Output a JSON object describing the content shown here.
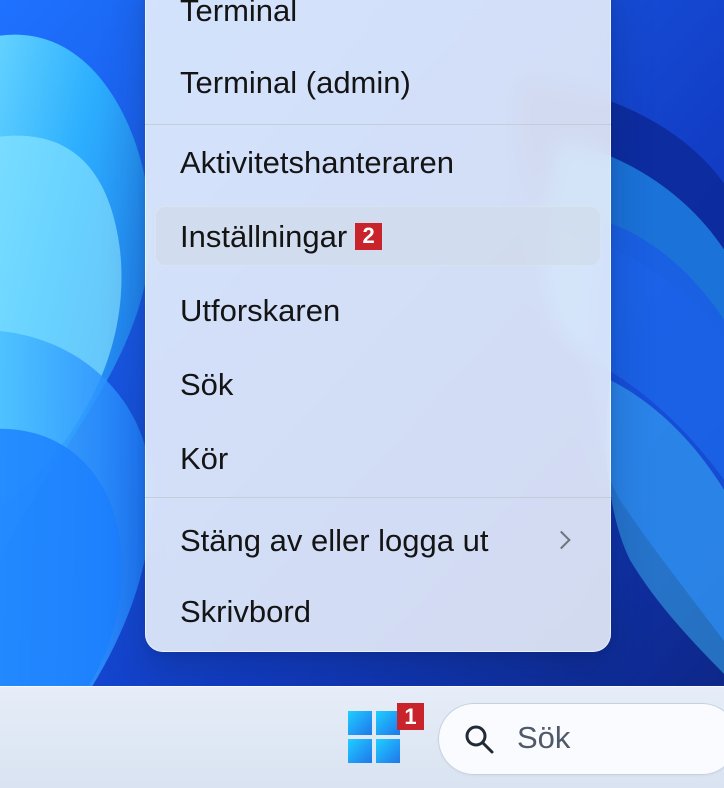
{
  "menu": {
    "items": [
      {
        "label": "Terminal"
      },
      {
        "label": "Terminal (admin)"
      },
      {
        "label": "Aktivitetshanteraren"
      },
      {
        "label": "Inställningar",
        "badge": "2"
      },
      {
        "label": "Utforskaren"
      },
      {
        "label": "Sök"
      },
      {
        "label": "Kör"
      },
      {
        "label": "Stäng av eller logga ut"
      },
      {
        "label": "Skrivbord"
      }
    ]
  },
  "taskbar": {
    "start_badge": "1",
    "search_placeholder": "Sök"
  },
  "colors": {
    "accent_red": "#c9242b",
    "start_blue": "#1f9df6",
    "wallpaper_blue": "#1b6df2",
    "menu_background": "#f2f7fd"
  },
  "icons": {
    "start": "windows-start-icon",
    "search": "search-icon",
    "submenu": "chevron-right-icon"
  }
}
